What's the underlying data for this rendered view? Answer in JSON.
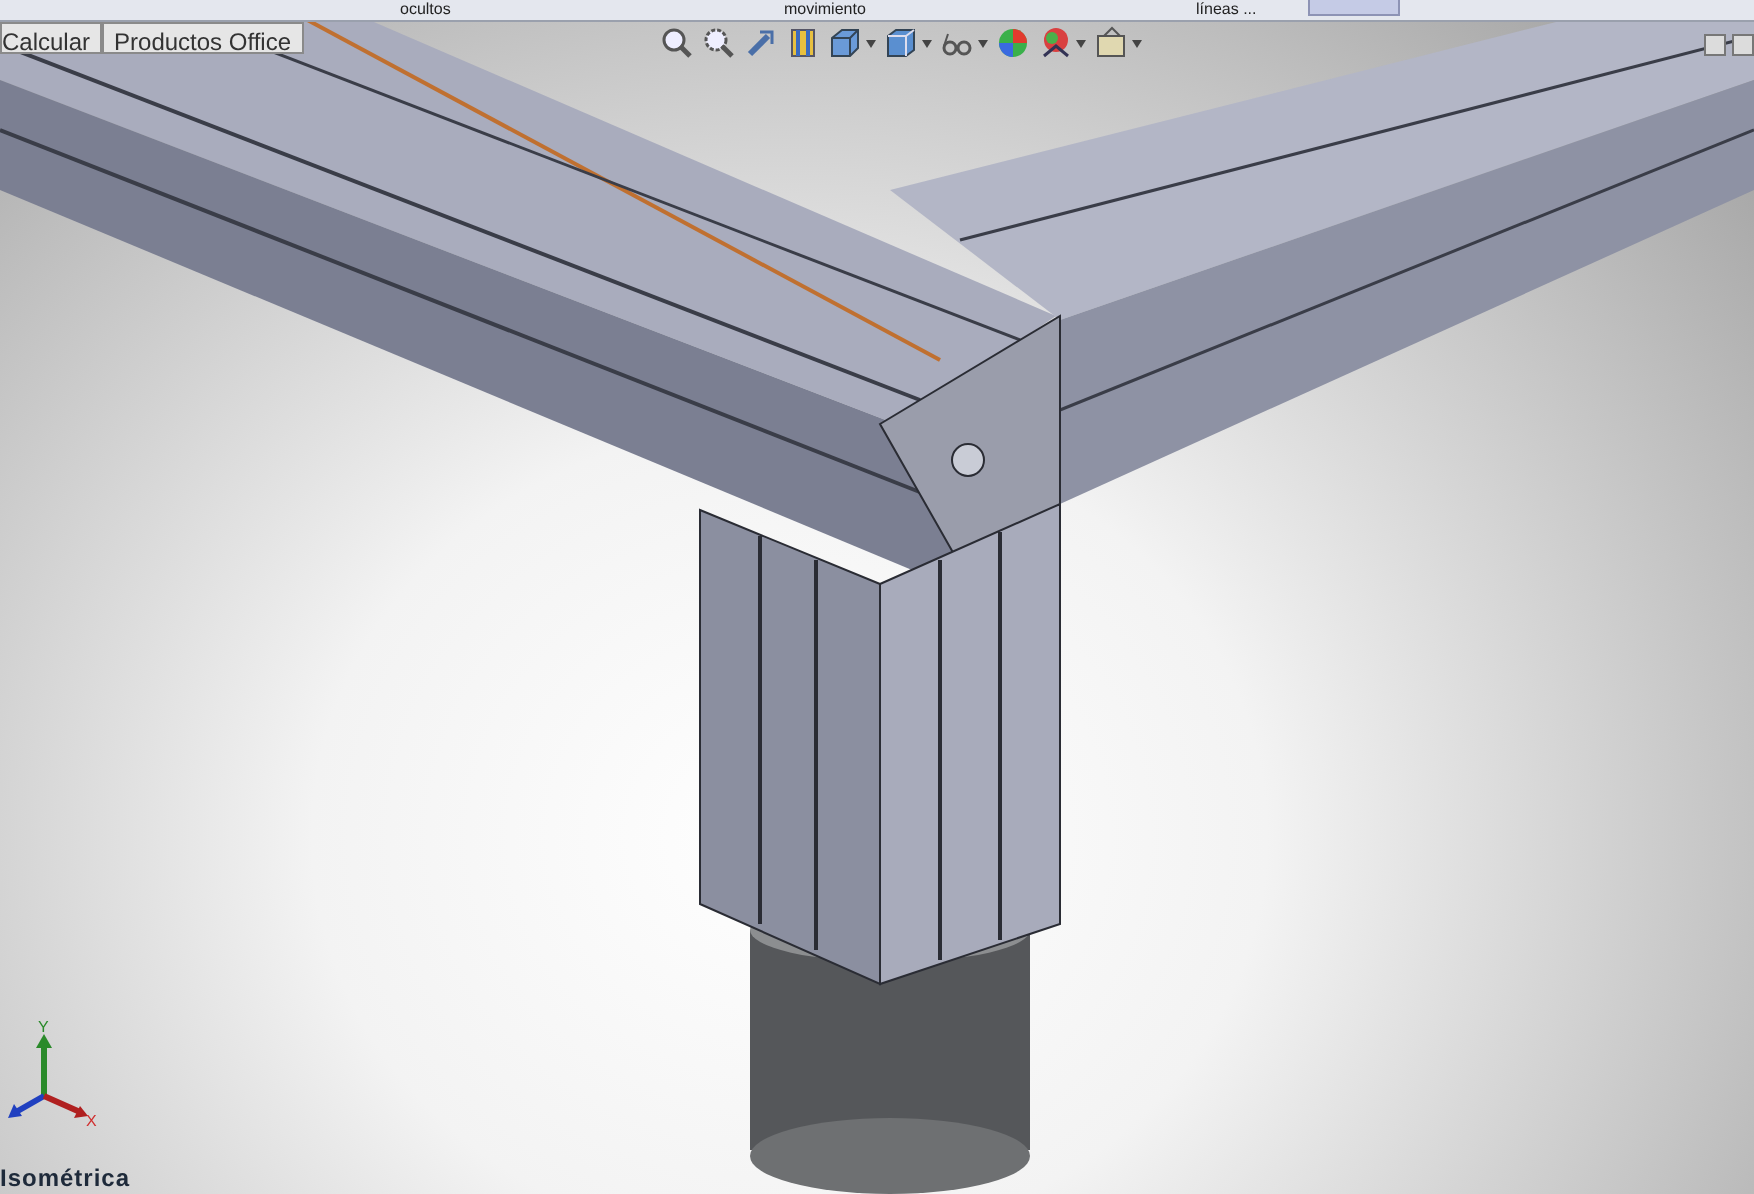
{
  "ribbon": {
    "labels": [
      {
        "text": "ocultos"
      },
      {
        "text": "movimiento"
      },
      {
        "text": "líneas ..."
      }
    ]
  },
  "tabs": [
    {
      "label": "Calcular"
    },
    {
      "label": "Productos Office"
    }
  ],
  "viewport": {
    "view_name": "Isométrica",
    "triad": {
      "y_label": "Y",
      "x_label": "X"
    }
  }
}
